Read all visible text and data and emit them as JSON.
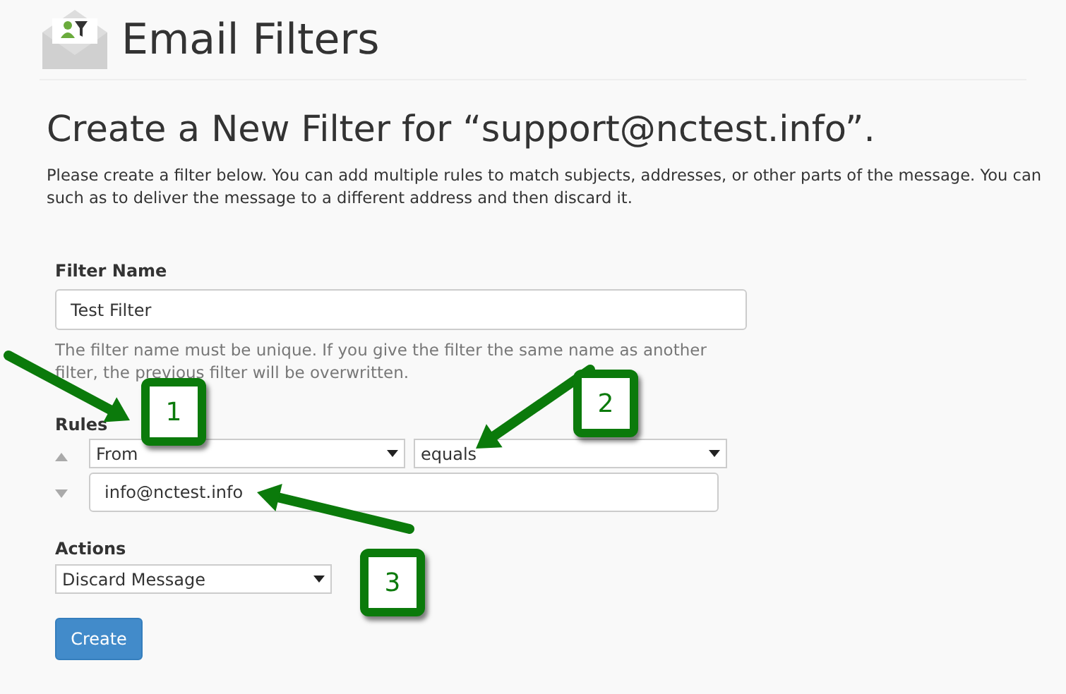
{
  "header": {
    "title": "Email Filters"
  },
  "heading": "Create a New Filter for “support@nctest.info”.",
  "intro": [
    "Please create a filter below. You can add multiple rules to match subjects, addresses, or other parts of the message. You can",
    "such as to deliver the message to a different address and then discard it."
  ],
  "filter_name": {
    "label": "Filter Name",
    "value": "Test Filter",
    "help": "The filter name must be unique. If you give the filter the same name as another filter, the previous filter will be overwritten."
  },
  "rules": {
    "label": "Rules",
    "field": "From",
    "operator": "equals",
    "value": "info@nctest.info"
  },
  "actions": {
    "label": "Actions",
    "action": "Discard Message"
  },
  "create_button": "Create",
  "annotations": [
    {
      "label": "1"
    },
    {
      "label": "2"
    },
    {
      "label": "3"
    }
  ]
}
